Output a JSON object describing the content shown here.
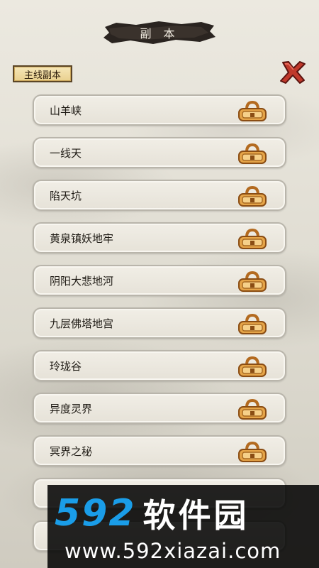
{
  "header": {
    "title": "副 本"
  },
  "tabs": {
    "main": "主线副本"
  },
  "icons": {
    "close": "close-x-icon",
    "lock": "lock-icon"
  },
  "colors": {
    "accent": "#c0392b",
    "lock_gold": "#d89a3c",
    "tab_bg": "#f0dca0"
  },
  "dungeons": [
    {
      "name": "山羊峡",
      "locked": true
    },
    {
      "name": "一线天",
      "locked": true
    },
    {
      "name": "陷天坑",
      "locked": true
    },
    {
      "name": "黄泉镇妖地牢",
      "locked": true
    },
    {
      "name": "阴阳大悲地河",
      "locked": true
    },
    {
      "name": "九层佛塔地宫",
      "locked": true
    },
    {
      "name": "玲珑谷",
      "locked": true
    },
    {
      "name": "异度灵界",
      "locked": true
    },
    {
      "name": "冥界之秘",
      "locked": true
    },
    {
      "name": "",
      "locked": true
    },
    {
      "name": "",
      "locked": true
    }
  ],
  "watermark": {
    "logo_num": "592",
    "logo_text": "软件园",
    "url": "www.592xiazai.com"
  }
}
